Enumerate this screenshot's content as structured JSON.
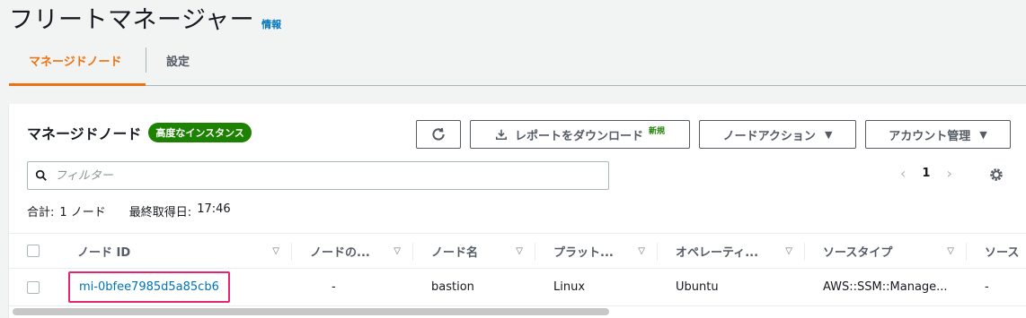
{
  "page": {
    "title": "フリートマネージャー",
    "info_link": "情報"
  },
  "tabs": [
    {
      "label": "マネージドノード",
      "active": true
    },
    {
      "label": "設定",
      "active": false
    }
  ],
  "panel": {
    "title": "マネージドノード",
    "badge": "高度なインスタンス",
    "buttons": {
      "refresh_icon": "refresh-icon",
      "download_label": "レポートをダウンロード",
      "download_new": "新規",
      "node_actions": "ノードアクション",
      "account_mgmt": "アカウント管理"
    },
    "search": {
      "placeholder": "フィルター",
      "value": ""
    },
    "pager": {
      "page": "1"
    },
    "summary": {
      "total_label": "合計:",
      "total_value": "1 ノード",
      "last_fetch_label": "最終取得日:",
      "last_fetch_value": "17:46"
    }
  },
  "table": {
    "columns": [
      "ノード ID",
      "ノードの...",
      "ノード名",
      "プラット...",
      "オペレーティ...",
      "ソースタイプ",
      "ソース"
    ],
    "rows": [
      {
        "node_id": "mi-0bfee7985d5a85cb6",
        "node_status": "-",
        "node_name": "bastion",
        "platform": "Linux",
        "os": "Ubuntu",
        "source_type": "AWS::SSM::Manage...",
        "source": "-"
      }
    ]
  },
  "colors": {
    "accent": "#ec7211",
    "link": "#0073bb",
    "badge_green": "#1d8102",
    "highlight": "#e7246e"
  }
}
